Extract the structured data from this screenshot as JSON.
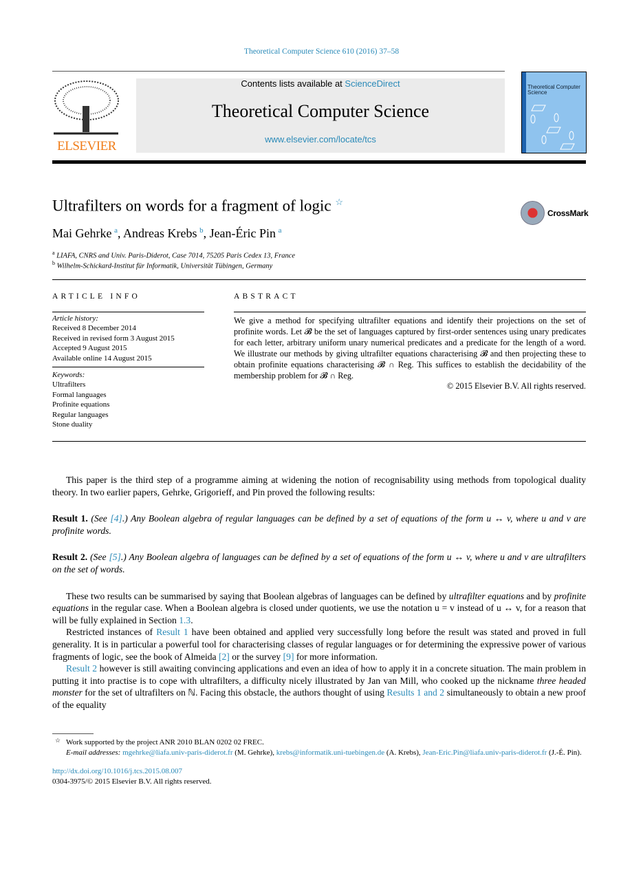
{
  "header": {
    "citation": "Theoretical Computer Science 610 (2016) 37–58",
    "contents_prefix": "Contents lists available at ",
    "sciencedirect": "ScienceDirect",
    "journal_title": "Theoretical Computer Science",
    "journal_url": "www.elsevier.com/locate/tcs",
    "publisher_logo": "ELSEVIER",
    "cover_title": "Theoretical Computer Science",
    "brand_color": "#f07d1a",
    "link_color": "#2a8ab8"
  },
  "article": {
    "title": "Ultrafilters on words for a fragment of logic",
    "title_mark": "☆",
    "crossmark": "CrossMark",
    "authors": [
      {
        "name": "Mai Gehrke",
        "aff": "a"
      },
      {
        "name": "Andreas Krebs",
        "aff": "b"
      },
      {
        "name": "Jean-Éric Pin",
        "aff": "a"
      }
    ],
    "affiliations": [
      {
        "mark": "a",
        "text": "LIAFA, CNRS and Univ. Paris-Diderot, Case 7014, 75205 Paris Cedex 13, France"
      },
      {
        "mark": "b",
        "text": "Wilhelm-Schickard-Institut für Informatik, Universität Tübingen, Germany"
      }
    ]
  },
  "article_info": {
    "heading": "ARTICLE INFO",
    "history_label": "Article history:",
    "history": [
      "Received 8 December 2014",
      "Received in revised form 3 August 2015",
      "Accepted 9 August 2015",
      "Available online 14 August 2015"
    ],
    "keywords_label": "Keywords:",
    "keywords": [
      "Ultrafilters",
      "Formal languages",
      "Profinite equations",
      "Regular languages",
      "Stone duality"
    ]
  },
  "abstract": {
    "heading": "ABSTRACT",
    "text": "We give a method for specifying ultrafilter equations and identify their projections on the set of profinite words. Let 𝓑 be the set of languages captured by first-order sentences using unary predicates for each letter, arbitrary uniform unary numerical predicates and a predicate for the length of a word. We illustrate our methods by giving ultrafilter equations characterising 𝓑 and then projecting these to obtain profinite equations characterising 𝓑 ∩ Reg. This suffices to establish the decidability of the membership problem for 𝓑 ∩ Reg.",
    "copyright": "© 2015 Elsevier B.V. All rights reserved."
  },
  "body": [
    {
      "cls": "ind",
      "segs": [
        {
          "t": "This paper is the third step of a programme aiming at widening the notion of recognisability using methods from topological duality theory. In two earlier papers, Gehrke, Grigorieff, and Pin proved the following results:"
        }
      ]
    },
    {
      "cls": "res",
      "segs": [
        {
          "b": "Result 1."
        },
        {
          "t": " (See "
        },
        {
          "l": "[4]"
        },
        {
          "t": ".) Any Boolean algebra of regular languages can be defined by a set of equations of the form u ↔ v, where u and v are profinite words."
        }
      ]
    },
    {
      "cls": "res",
      "segs": [
        {
          "b": "Result 2."
        },
        {
          "t": " (See "
        },
        {
          "l": "[5]"
        },
        {
          "t": ".) Any Boolean algebra of languages can be defined by a set of equations of the form u ↔ v, where u and v are ultrafilters on the set of words."
        }
      ]
    },
    {
      "cls": "ind",
      "segs": [
        {
          "t": "These two results can be summarised by saying that Boolean algebras of languages can be defined by "
        },
        {
          "i": "ultrafilter equations"
        },
        {
          "t": " and by "
        },
        {
          "i": "profinite equations"
        },
        {
          "t": " in the regular case. When a Boolean algebra is closed under quotients, we use the notation u = v instead of u ↔ v, for a reason that will be fully explained in Section "
        },
        {
          "l": "1.3"
        },
        {
          "t": "."
        }
      ]
    },
    {
      "cls": "ind",
      "segs": [
        {
          "t": "Restricted instances of "
        },
        {
          "l": "Result 1"
        },
        {
          "t": " have been obtained and applied very successfully long before the result was stated and proved in full generality. It is in particular a powerful tool for characterising classes of regular languages or for determining the expressive power of various fragments of logic, see the book of Almeida "
        },
        {
          "l": "[2]"
        },
        {
          "t": " or the survey "
        },
        {
          "l": "[9]"
        },
        {
          "t": " for more information."
        }
      ]
    },
    {
      "cls": "ind",
      "segs": [
        {
          "l": "Result 2"
        },
        {
          "t": " however is still awaiting convincing applications and even an idea of how to apply it in a concrete situation. The main problem in putting it into practise is to cope with ultrafilters, a difficulty nicely illustrated by Jan van Mill, who cooked up the nickname "
        },
        {
          "i": "three headed monster"
        },
        {
          "t": " for the set of ultrafilters on ℕ. Facing this obstacle, the authors thought of using "
        },
        {
          "l": "Results 1 and 2"
        },
        {
          "t": " simultaneously to obtain a new proof of the equality"
        }
      ]
    }
  ],
  "footnotes": {
    "star": "☆",
    "funding": "Work supported by the project ANR 2010 BLAN 0202 02 FREC.",
    "email_label": "E-mail addresses:",
    "emails": [
      {
        "addr": "mgehrke@liafa.univ-paris-diderot.fr",
        "who": " (M. Gehrke), "
      },
      {
        "addr": "krebs@informatik.uni-tuebingen.de",
        "who": " (A. Krebs), "
      },
      {
        "addr": "Jean-Eric.Pin@liafa.univ-paris-diderot.fr",
        "who": " (J.-É. Pin)."
      }
    ],
    "doi": "http://dx.doi.org/10.1016/j.tcs.2015.08.007",
    "issn": "0304-3975/© 2015 Elsevier B.V. All rights reserved."
  }
}
